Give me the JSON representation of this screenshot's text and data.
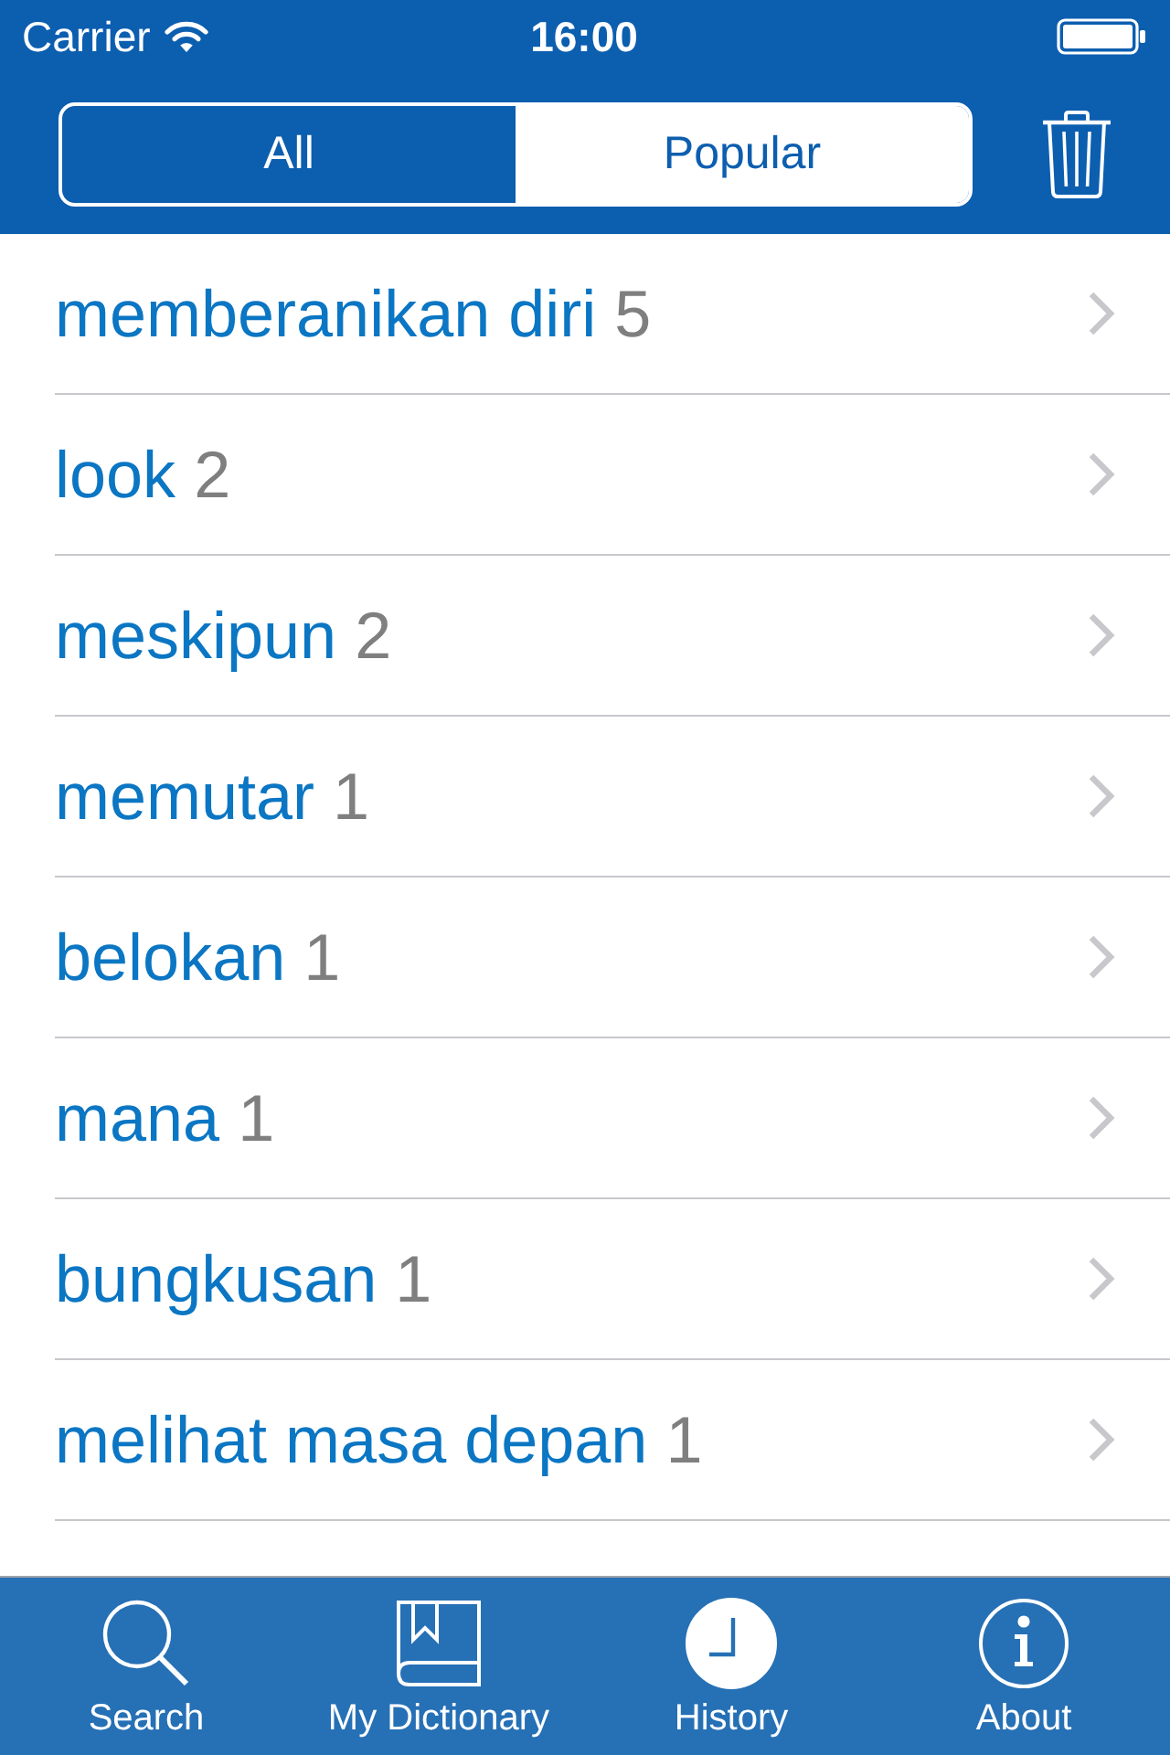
{
  "status_bar": {
    "carrier": "Carrier",
    "time": "16:00"
  },
  "segmented_control": [
    {
      "label": "All",
      "selected": false
    },
    {
      "label": "Popular",
      "selected": true
    }
  ],
  "history": [
    {
      "word": "memberanikan diri",
      "count": "5"
    },
    {
      "word": "look",
      "count": "2"
    },
    {
      "word": "meskipun",
      "count": "2"
    },
    {
      "word": "memutar",
      "count": "1"
    },
    {
      "word": "belokan",
      "count": "1"
    },
    {
      "word": "mana",
      "count": "1"
    },
    {
      "word": "bungkusan",
      "count": "1"
    },
    {
      "word": "melihat masa depan",
      "count": "1"
    }
  ],
  "tab_bar": [
    {
      "label": "Search",
      "selected": false
    },
    {
      "label": "My Dictionary",
      "selected": false
    },
    {
      "label": "History",
      "selected": true
    },
    {
      "label": "About",
      "selected": false
    }
  ]
}
